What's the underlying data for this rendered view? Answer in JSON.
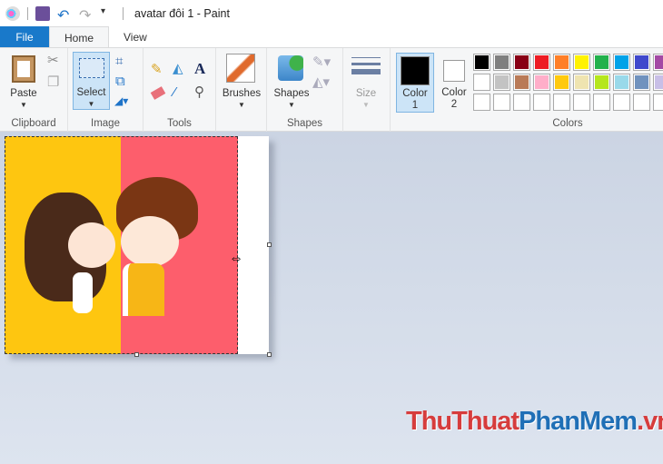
{
  "window": {
    "title": "avatar đôi 1 - Paint"
  },
  "tabs": [
    {
      "label": "File"
    },
    {
      "label": "Home"
    },
    {
      "label": "View"
    }
  ],
  "ribbon": {
    "clipboard": {
      "label": "Clipboard",
      "paste": "Paste"
    },
    "image": {
      "label": "Image",
      "select": "Select"
    },
    "tools": {
      "label": "Tools"
    },
    "brushes": {
      "label": "Brushes"
    },
    "shapes": {
      "label": "Shapes",
      "shapes_btn": "Shapes"
    },
    "size": {
      "label": "Size"
    },
    "colors": {
      "label": "Colors",
      "color1": "Color 1",
      "color1_num": "1",
      "color1_word": "Color",
      "color2_word": "Color",
      "color2_num": "2",
      "color1_value": "#000000",
      "color2_value": "#ffffff",
      "palette_row1": [
        "#000000",
        "#7f7f7f",
        "#880015",
        "#ed1c24",
        "#ff7f27",
        "#fff200",
        "#22b14c",
        "#00a2e8",
        "#3f48cc",
        "#a349a4"
      ],
      "palette_row2": [
        "#ffffff",
        "#c3c3c3",
        "#b97a57",
        "#ffaec9",
        "#ffc90e",
        "#efe4b0",
        "#b5e61d",
        "#99d9ea",
        "#7092be",
        "#c8bfe7"
      ]
    }
  },
  "watermark": {
    "part1": "ThuThuat",
    "part2": "PhanMem",
    "part3": ".vn"
  }
}
